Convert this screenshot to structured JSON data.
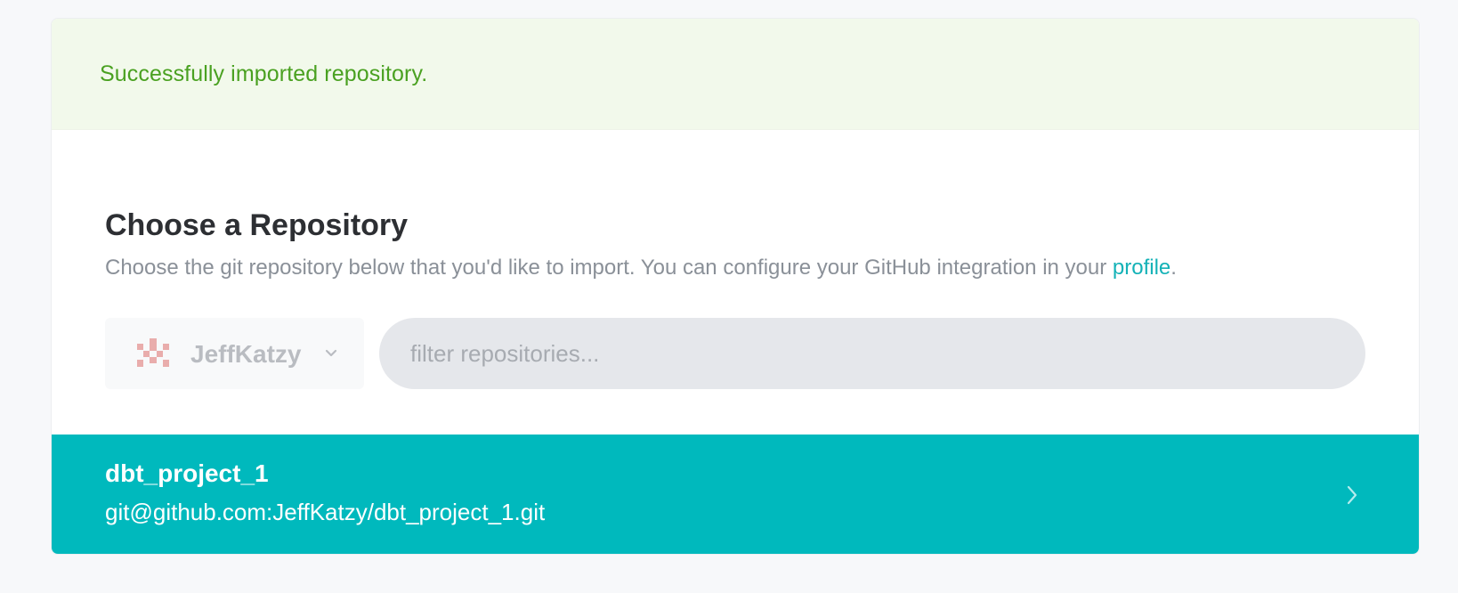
{
  "banner": {
    "message": "Successfully imported repository."
  },
  "header": {
    "title": "Choose a Repository",
    "subtitle_text": "Choose the git repository below that you'd like to import. You can configure your GitHub integration in your ",
    "subtitle_link": "profile",
    "subtitle_end": "."
  },
  "owner_selector": {
    "selected": "JeffKatzy",
    "avatar_icon": "identicon-avatar",
    "chevron_icon": "chevron-down-icon"
  },
  "search": {
    "placeholder": "filter repositories...",
    "value": ""
  },
  "repositories": [
    {
      "name": "dbt_project_1",
      "url": "git@github.com:JeffKatzy/dbt_project_1.git",
      "icon": "chevron-right-icon"
    }
  ],
  "colors": {
    "success_text": "#4aa121",
    "success_bg": "#f2f9eb",
    "accent": "#00b9bd",
    "link": "#14b2b7"
  }
}
